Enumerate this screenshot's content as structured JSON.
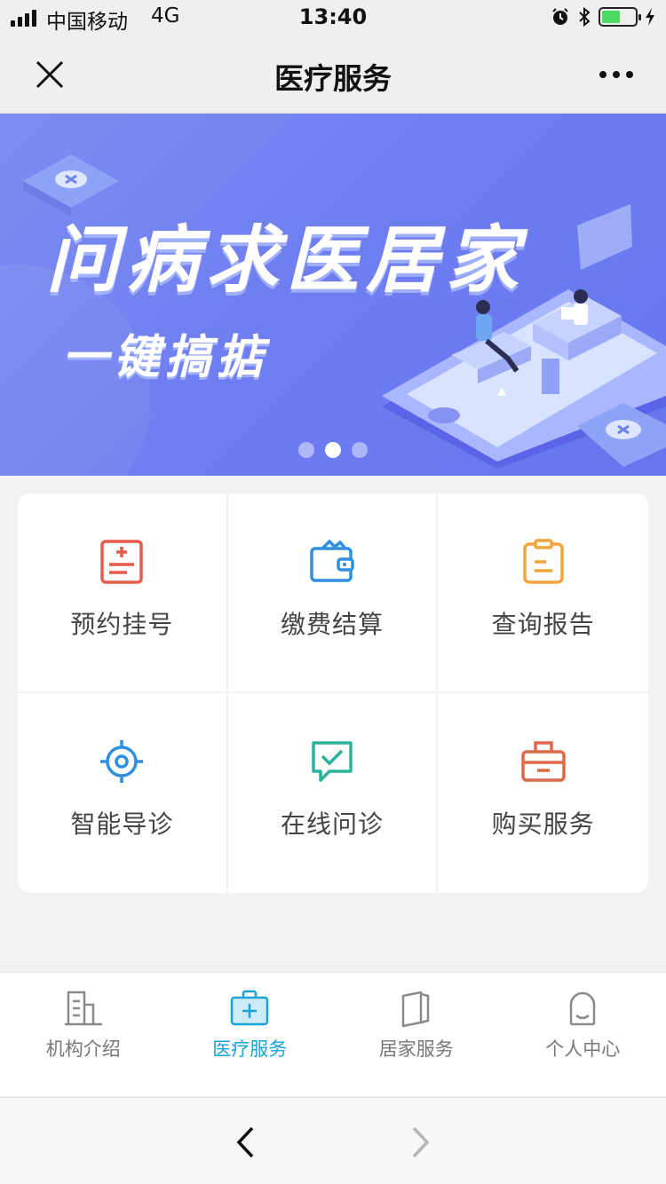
{
  "status_bar": {
    "carrier": "中国移动",
    "network": "4G",
    "time": "13:40",
    "battery_level": 0.55
  },
  "navbar": {
    "title": "医疗服务",
    "close_icon": "close-icon",
    "more_icon": "more-icon"
  },
  "banner": {
    "title": "问病求医居家",
    "subtitle": "一键搞掂",
    "slide_count": 3,
    "active_slide": 2
  },
  "services": [
    {
      "label": "预约挂号",
      "icon": "register-icon",
      "color": "#e65b4b"
    },
    {
      "label": "缴费结算",
      "icon": "wallet-icon",
      "color": "#2f8fe0"
    },
    {
      "label": "查询报告",
      "icon": "report-icon",
      "color": "#f0a43a"
    },
    {
      "label": "智能导诊",
      "icon": "target-icon",
      "color": "#2f8fe0"
    },
    {
      "label": "在线问诊",
      "icon": "chat-check-icon",
      "color": "#2bb39b"
    },
    {
      "label": "购买服务",
      "icon": "shopping-bag-icon",
      "color": "#e0684a"
    }
  ],
  "tabbar": {
    "items": [
      {
        "label": "机构介绍",
        "icon": "building-icon",
        "active": false
      },
      {
        "label": "医疗服务",
        "icon": "medical-kit-icon",
        "active": true
      },
      {
        "label": "居家服务",
        "icon": "home-service-icon",
        "active": false
      },
      {
        "label": "个人中心",
        "icon": "user-icon",
        "active": false
      }
    ],
    "active_color": "#1aa3d6",
    "inactive_color": "#777777"
  },
  "browser_bar": {
    "back_icon": "chevron-left-icon",
    "forward_icon": "chevron-right-icon"
  }
}
